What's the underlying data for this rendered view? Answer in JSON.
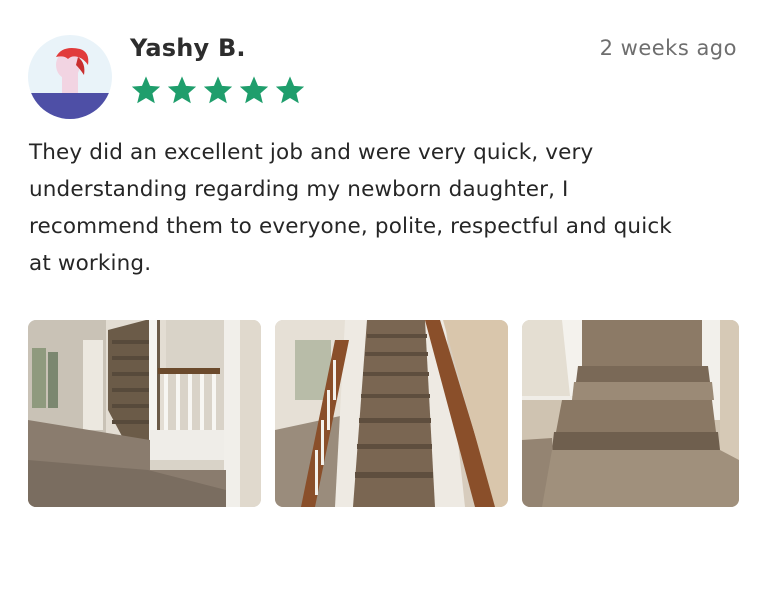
{
  "review": {
    "author": "Yashy B.",
    "time_ago": "2 weeks ago",
    "rating": 5,
    "max_rating": 5,
    "lines": [
      "They did an excellent job and were very quick, very",
      "understanding regarding my newborn daughter, I",
      "recommend them to everyone, polite, respectful and quick",
      "at working."
    ]
  },
  "avatar": {
    "icon": "person-avatar-icon",
    "colors": {
      "bg": "#e8f2f8",
      "hair": "#e03a3a",
      "shirt": "#4f4fa8",
      "skin": "#f3d6e3"
    }
  },
  "star_color": "#1f9e6c",
  "photos": [
    {
      "name": "staircase-photo-1",
      "icon": "photo-thumbnail"
    },
    {
      "name": "staircase-photo-2",
      "icon": "photo-thumbnail"
    },
    {
      "name": "staircase-photo-3",
      "icon": "photo-thumbnail"
    }
  ]
}
